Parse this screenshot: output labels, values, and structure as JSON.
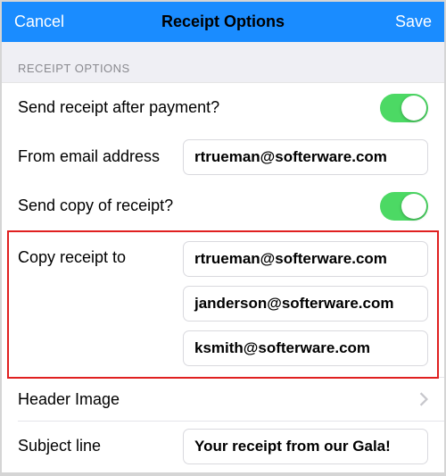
{
  "navbar": {
    "cancel": "Cancel",
    "title": "Receipt Options",
    "save": "Save"
  },
  "section_header": "RECEIPT OPTIONS",
  "rows": {
    "send_after_payment": {
      "label": "Send receipt after payment?",
      "on": true
    },
    "from_email": {
      "label": "From email address",
      "value": "rtrueman@softerware.com"
    },
    "send_copy": {
      "label": "Send copy of receipt?",
      "on": true
    },
    "copy_to": {
      "label": "Copy receipt to",
      "values": [
        "rtrueman@softerware.com",
        "janderson@softerware.com",
        "ksmith@softerware.com"
      ]
    },
    "header_image": {
      "label": "Header Image"
    },
    "subject": {
      "label": "Subject line",
      "value": "Your receipt from our Gala!"
    }
  }
}
